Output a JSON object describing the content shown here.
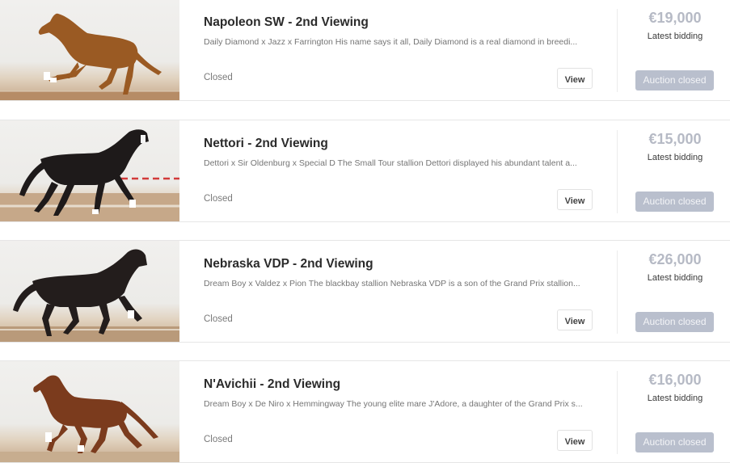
{
  "auctions": [
    {
      "title": "Napoleon SW - 2nd Viewing",
      "description": "Daily Diamond x Jazz x Farrington His name says it all, Daily Diamond is a real diamond in breedi...",
      "status": "Closed",
      "view_label": "View",
      "price": "€19,000",
      "price_label": "Latest bidding",
      "closed_label": "Auction closed",
      "horse_color": "#9a5a23"
    },
    {
      "title": "Nettori - 2nd Viewing",
      "description": "Dettori x Sir Oldenburg x Special D The Small Tour stallion Dettori displayed his abundant talent a...",
      "status": "Closed",
      "view_label": "View",
      "price": "€15,000",
      "price_label": "Latest bidding",
      "closed_label": "Auction closed",
      "horse_color": "#1e1a1a"
    },
    {
      "title": "Nebraska VDP - 2nd Viewing",
      "description": "Dream Boy x Valdez x Pion The blackbay stallion Nebraska VDP is a son of the Grand Prix stallion...",
      "status": "Closed",
      "view_label": "View",
      "price": "€26,000",
      "price_label": "Latest bidding",
      "closed_label": "Auction closed",
      "horse_color": "#231d1c"
    },
    {
      "title": "N'Avichii - 2nd Viewing",
      "description": "Dream Boy x De Niro x Hemmingway The young elite mare J'Adore, a daughter of the Grand Prix s...",
      "status": "Closed",
      "view_label": "View",
      "price": "€16,000",
      "price_label": "Latest bidding",
      "closed_label": "Auction closed",
      "horse_color": "#7b3b1d"
    }
  ]
}
